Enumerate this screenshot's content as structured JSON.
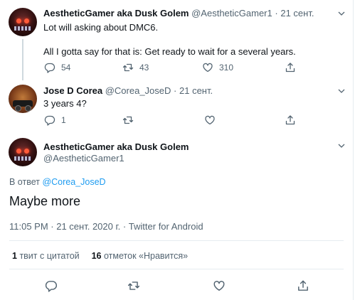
{
  "tweets": [
    {
      "name": "AestheticGamer aka Dusk Golem",
      "handle": "@AestheticGamer1",
      "dot": "·",
      "date": "21 сент.",
      "lines": [
        "Lot will asking about DMC6.",
        "All I gotta say for that is: Get ready to wait for a several years."
      ],
      "replies": "54",
      "retweets": "43",
      "likes": "310"
    },
    {
      "name": "Jose D Corea",
      "handle": "@Corea_JoseD",
      "dot": "·",
      "date": "21 сент.",
      "lines": [
        "3 years 4?"
      ],
      "replies": "1",
      "retweets": "",
      "likes": ""
    }
  ],
  "main": {
    "name": "AestheticGamer aka Dusk Golem",
    "handle": "@AestheticGamer1",
    "reply_prefix": "В ответ",
    "reply_to": "@Corea_JoseD",
    "text": "Maybe more",
    "timestamp": "11:05 PM · 21 сент. 2020 г. · Twitter for Android",
    "quote_count": "1",
    "quote_label": "твит с цитатой",
    "like_count": "16",
    "like_label": "отметок «Нравится»"
  },
  "icons": [
    "reply-icon",
    "retweet-icon",
    "like-icon",
    "share-icon",
    "chevron-down-icon"
  ],
  "colors": {
    "accent": "#1d9bf0",
    "muted": "#536471",
    "text": "#0f1419"
  }
}
